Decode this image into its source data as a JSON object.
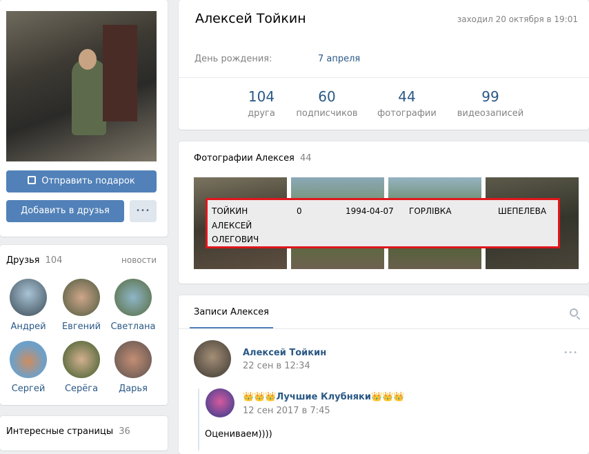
{
  "profile": {
    "name": "Алексей Тойкин",
    "last_seen": "заходил 20 октября в 19:01",
    "birthday_label": "День рождения:",
    "birthday_value": "7 апреля",
    "gift_button": "Отправить подарок",
    "add_friend_button": "Добавить в друзья",
    "more_button": "•••"
  },
  "stats": [
    {
      "num": "104",
      "label": "друга"
    },
    {
      "num": "60",
      "label": "подписчиков"
    },
    {
      "num": "44",
      "label": "фотографии"
    },
    {
      "num": "99",
      "label": "видеозаписей"
    }
  ],
  "friends": {
    "title": "Друзья",
    "count": "104",
    "news_link": "новости",
    "list": [
      "Андрей",
      "Евгений",
      "Светлана",
      "Сергей",
      "Серёга",
      "Дарья"
    ]
  },
  "interesting": {
    "title": "Интересные страницы",
    "count": "36"
  },
  "photos": {
    "title": "Фотографии Алексея",
    "count": "44",
    "overlay": {
      "name1": "ТОЙКИН",
      "name2": "АЛЕКСЕЙ",
      "name3": "ОЛЕГОВИЧ",
      "zero": "0",
      "date": "1994-04-07",
      "city": "ГОРЛІВКА",
      "street": "ШЕПЕЛЕВА"
    }
  },
  "wall": {
    "tab": "Записи Алексея",
    "post": {
      "author": "Алексей Тойкин",
      "date": "22 сен в 12:34",
      "repost_author": "👑👑👑Лучшие Клубняки👑👑👑",
      "repost_date": "12 сен 2017 в 7:45",
      "text": "Оцениваем))))"
    }
  },
  "colors": {
    "accent": "#5181b8",
    "link": "#2a5885",
    "highlight_border": "#e0161b"
  }
}
